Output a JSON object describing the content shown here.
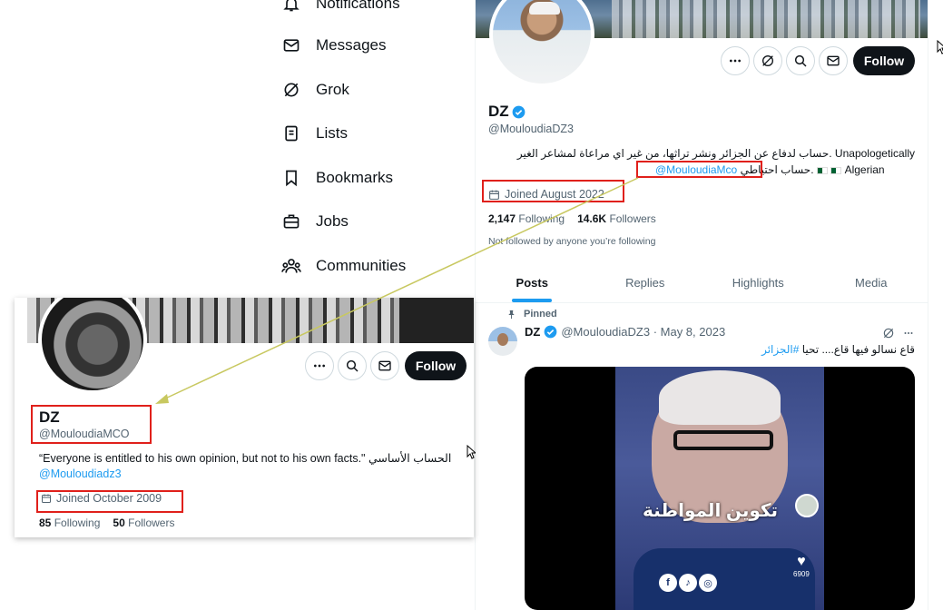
{
  "nav": {
    "items": [
      {
        "label": "Notifications",
        "icon": "bell-icon"
      },
      {
        "label": "Messages",
        "icon": "envelope-icon"
      },
      {
        "label": "Grok",
        "icon": "grok-icon"
      },
      {
        "label": "Lists",
        "icon": "list-icon"
      },
      {
        "label": "Bookmarks",
        "icon": "bookmark-icon"
      },
      {
        "label": "Jobs",
        "icon": "briefcase-icon"
      },
      {
        "label": "Communities",
        "icon": "communities-icon"
      }
    ]
  },
  "profile": {
    "name": "DZ",
    "handle": "@MouloudiaDZ3",
    "bio_line1": "حساب لدفاع عن الجزائر ونشر تراثها، من غير اي مراعاة لمشاعر الغير. Unapologetically",
    "bio_line2_prefix": "Algerian",
    "bio_line2_arabic": "حساب احتياطي.",
    "bio_link": "@MouloudiaMco",
    "joined": "Joined August 2022",
    "following_count": "2,147",
    "following_label": "Following",
    "followers_count": "14.6K",
    "followers_label": "Followers",
    "not_followed": "Not followed by anyone you’re following",
    "follow_label": "Follow",
    "tabs": [
      "Posts",
      "Replies",
      "Highlights",
      "Media"
    ]
  },
  "post": {
    "pinned_label": "Pinned",
    "name": "DZ",
    "handle_date": "@MouloudiaDZ3 · May 8, 2023",
    "text_prefix": "قاع نسالو فيها قاع.... تحيا ",
    "hashtag": "#الجزائر",
    "media_caption": "تكوين المواطنة",
    "media_likes": "6909"
  },
  "card": {
    "name": "DZ",
    "handle": "@MouloudiaMCO",
    "bio_quote": "“Everyone is entitled to his own opinion, but not to his own facts.\"",
    "bio_arabic": "الحساب  الأساسي",
    "bio_link": "@Mouloudiadz3",
    "joined": "Joined October 2009",
    "following_count": "85",
    "following_label": "Following",
    "followers_count": "50",
    "followers_label": "Followers",
    "follow_label": "Follow"
  },
  "colors": {
    "accent": "#1d9bf0",
    "annotation_red": "#e0201b",
    "annotation_arrow": "#c8c860"
  }
}
